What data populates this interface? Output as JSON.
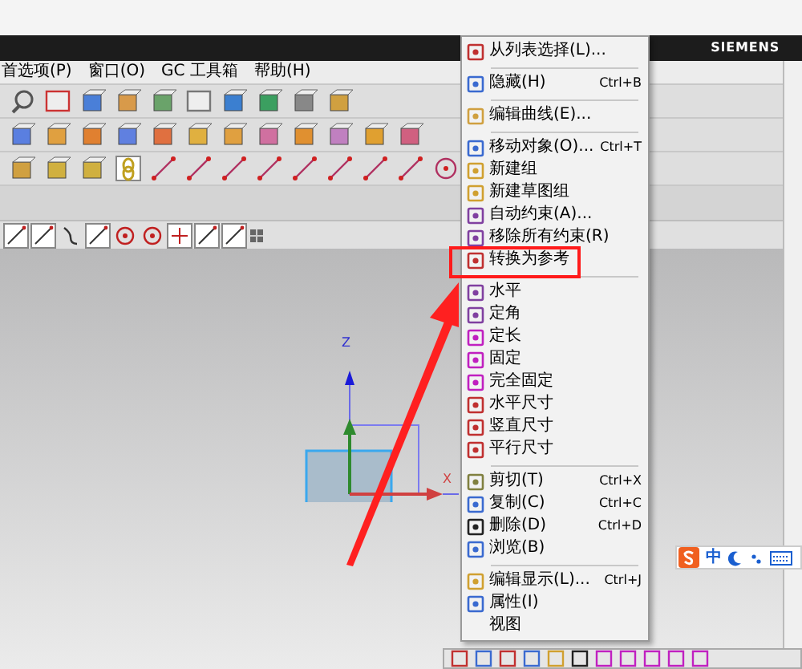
{
  "title_bar": {
    "brand": "SIEMENS"
  },
  "menu_bar": [
    "首选项(P)",
    "窗口(O)",
    "GC 工具箱",
    "帮助(H)"
  ],
  "context_menu": [
    {
      "kind": "item",
      "label": "从列表选择(L)...",
      "icon": true
    },
    {
      "kind": "separator"
    },
    {
      "kind": "item",
      "label": "隐藏(H)",
      "shortcut": "Ctrl+B",
      "icon": true
    },
    {
      "kind": "separator"
    },
    {
      "kind": "item",
      "label": "编辑曲线(E)...",
      "icon": true
    },
    {
      "kind": "separator"
    },
    {
      "kind": "item",
      "label": "移动对象(O)...",
      "shortcut": "Ctrl+T",
      "icon": true
    },
    {
      "kind": "item",
      "label": "新建组",
      "icon": true
    },
    {
      "kind": "item",
      "label": "新建草图组",
      "icon": true
    },
    {
      "kind": "item",
      "label": "自动约束(A)...",
      "icon": true
    },
    {
      "kind": "item",
      "label": "移除所有约束(R)",
      "icon": true
    },
    {
      "kind": "item",
      "label": "转换为参考",
      "icon": true
    },
    {
      "kind": "separator"
    },
    {
      "kind": "item",
      "label": "水平",
      "icon": true
    },
    {
      "kind": "item",
      "label": "定角",
      "icon": true
    },
    {
      "kind": "item",
      "label": "定长",
      "icon": true
    },
    {
      "kind": "item",
      "label": "固定",
      "icon": true
    },
    {
      "kind": "item",
      "label": "完全固定",
      "icon": true
    },
    {
      "kind": "item",
      "label": "水平尺寸",
      "icon": true
    },
    {
      "kind": "item",
      "label": "竖直尺寸",
      "icon": true
    },
    {
      "kind": "item",
      "label": "平行尺寸",
      "icon": true
    },
    {
      "kind": "separator"
    },
    {
      "kind": "item",
      "label": "剪切(T)",
      "shortcut": "Ctrl+X",
      "icon": true
    },
    {
      "kind": "item",
      "label": "复制(C)",
      "shortcut": "Ctrl+C",
      "icon": true
    },
    {
      "kind": "item",
      "label": "删除(D)",
      "shortcut": "Ctrl+D",
      "icon": true
    },
    {
      "kind": "item",
      "label": "浏览(B)",
      "icon": true
    },
    {
      "kind": "separator"
    },
    {
      "kind": "item",
      "label": "编辑显示(L)...",
      "shortcut": "Ctrl+J",
      "icon": true
    },
    {
      "kind": "item",
      "label": "属性(I)",
      "icon": true
    },
    {
      "kind": "item",
      "label": "视图",
      "icon": false
    }
  ],
  "viewport": {
    "axis_labels": [
      "Z",
      "X"
    ]
  },
  "ime_bar": {
    "mode": "中"
  }
}
